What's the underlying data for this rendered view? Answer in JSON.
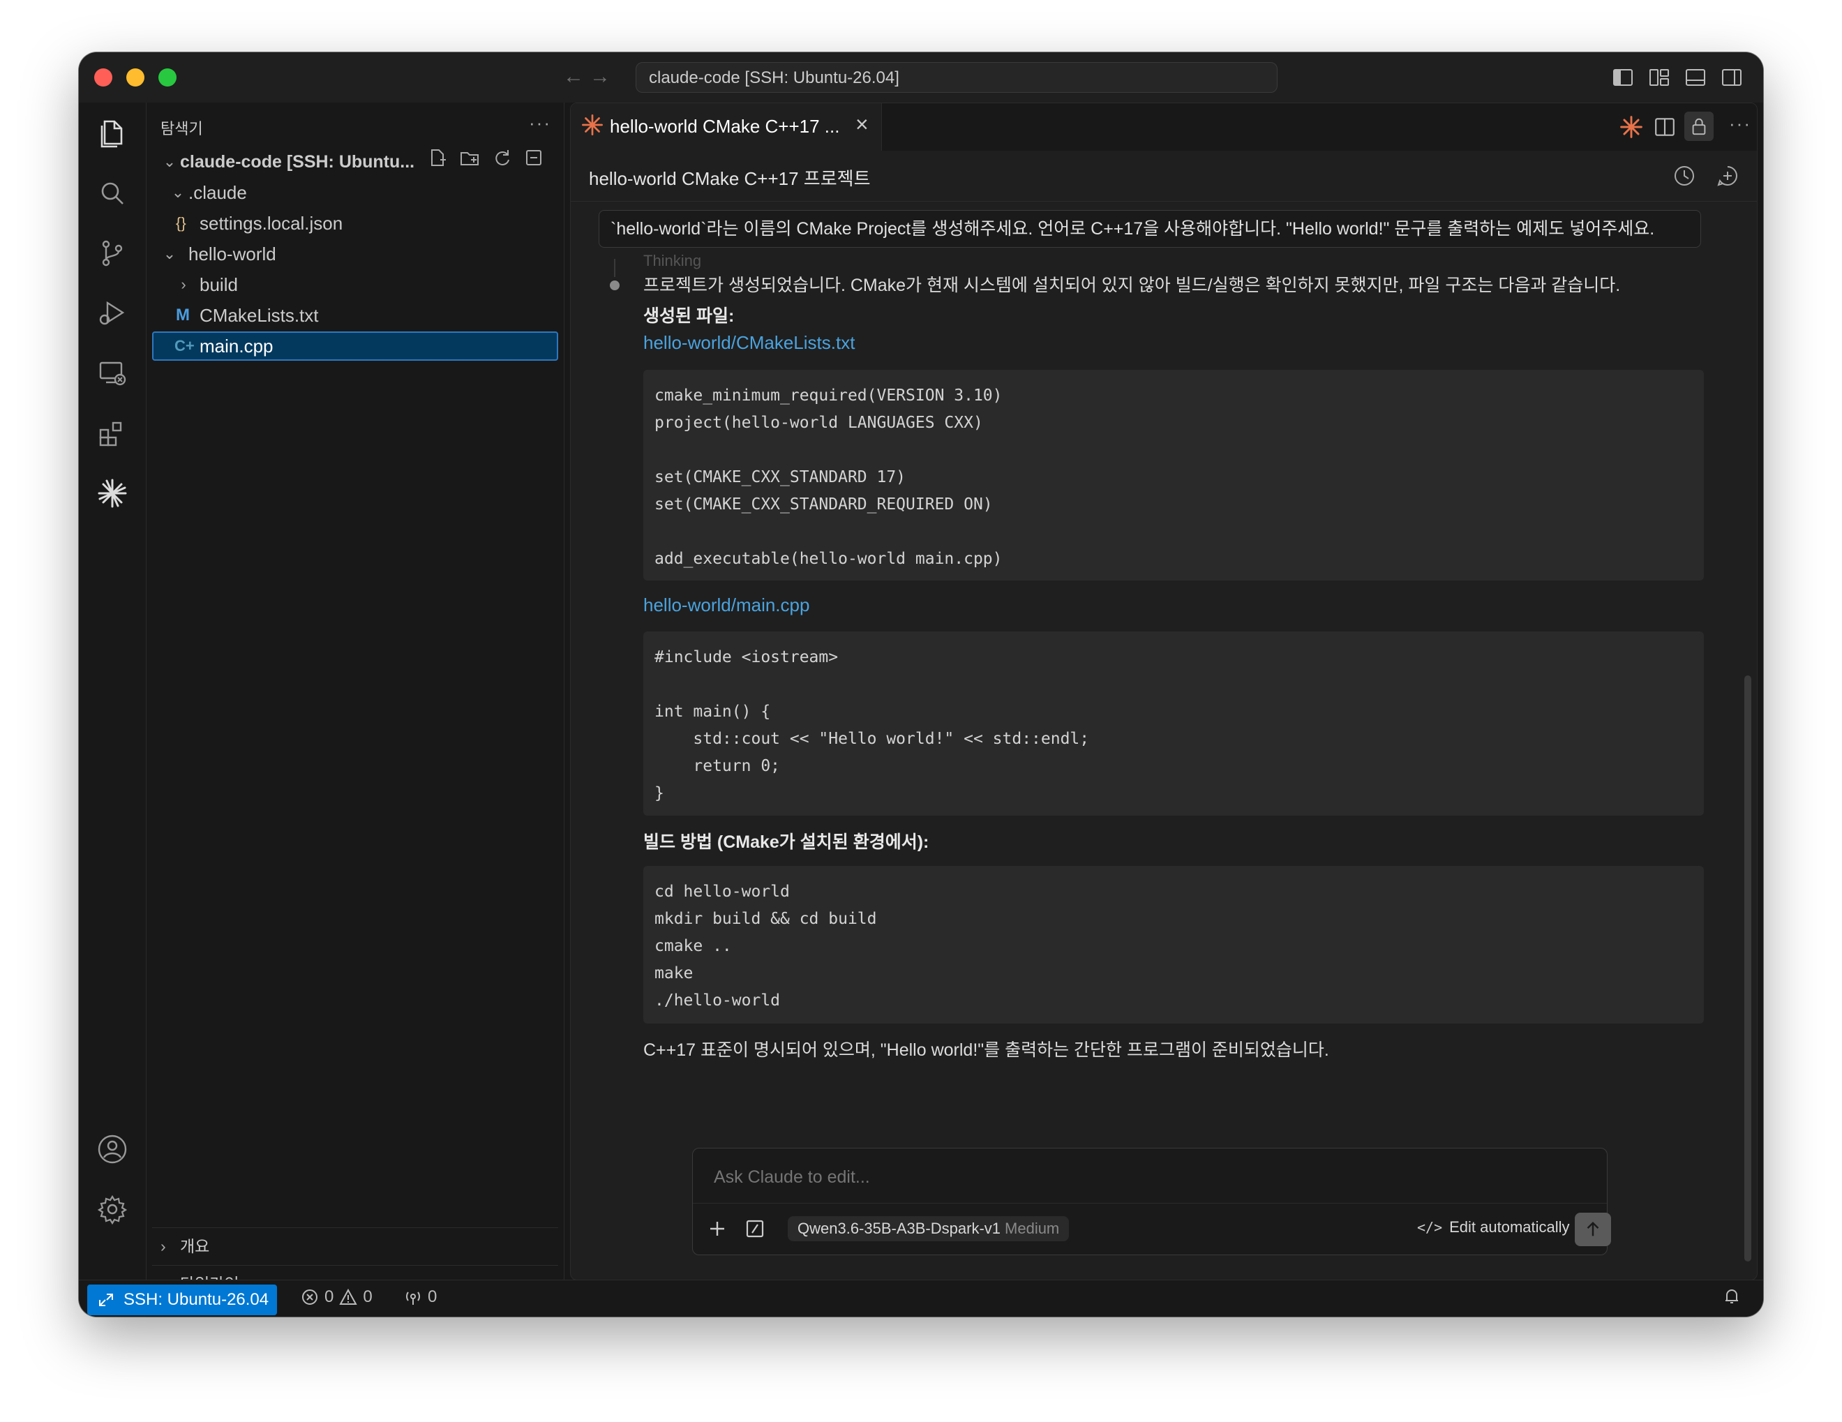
{
  "titlebar": {
    "command_center": "claude-code [SSH: Ubuntu-26.04]"
  },
  "sidebar": {
    "title": "탐색기",
    "more": "···",
    "root": "claude-code [SSH: Ubuntu...",
    "tree": [
      {
        "label": ".claude",
        "type": "folder-open"
      },
      {
        "label": "settings.local.json",
        "type": "json"
      },
      {
        "label": "hello-world",
        "type": "folder-open"
      },
      {
        "label": "build",
        "type": "folder-closed"
      },
      {
        "label": "CMakeLists.txt",
        "type": "cmake"
      },
      {
        "label": "main.cpp",
        "type": "cpp"
      }
    ],
    "sections": [
      "개요",
      "타임라인"
    ]
  },
  "editor": {
    "tab_title": "hello-world CMake C++17 ...",
    "header_title": "hello-world CMake C++17 프로젝트",
    "user_message": "`hello-world`라는 이름의 CMake Project를 생성해주세요. 언어로 C++17을 사용해야합니다. \"Hello world!\" 문구를 출력하는 예제도 넣어주세요.",
    "faded_label": "Thinking",
    "response": {
      "intro": "프로젝트가 생성되었습니다. CMake가 현재 시스템에 설치되어 있지 않아 빌드/실행은 확인하지 못했지만, 파일 구조는 다음과 같습니다.",
      "files_heading": "생성된 파일:",
      "file1_link": "hello-world/CMakeLists.txt",
      "file1_code": "cmake_minimum_required(VERSION 3.10)\nproject(hello-world LANGUAGES CXX)\n\nset(CMAKE_CXX_STANDARD 17)\nset(CMAKE_CXX_STANDARD_REQUIRED ON)\n\nadd_executable(hello-world main.cpp)",
      "file2_link": "hello-world/main.cpp",
      "file2_code": "#include <iostream>\n\nint main() {\n    std::cout << \"Hello world!\" << std::endl;\n    return 0;\n}",
      "build_heading": "빌드 방법 (CMake가 설치된 환경에서):",
      "build_code": "cd hello-world\nmkdir build && cd build\ncmake ..\nmake\n./hello-world",
      "outro": "C++17 표준이 명시되어 있으며, \"Hello world!\"를 출력하는 간단한 프로그램이 준비되었습니다."
    },
    "composer": {
      "placeholder": "Ask Claude to edit...",
      "model": "Qwen3.6-35B-A3B-Dspark-v1",
      "effort": "Medium",
      "mode": "Edit automatically"
    }
  },
  "statusbar": {
    "remote": "SSH: Ubuntu-26.04",
    "errors": "0",
    "warnings": "0",
    "ports": "0"
  },
  "colors": {
    "accent": "#0078d4",
    "claude_orange": "#e8734a",
    "link": "#4aa3df"
  }
}
